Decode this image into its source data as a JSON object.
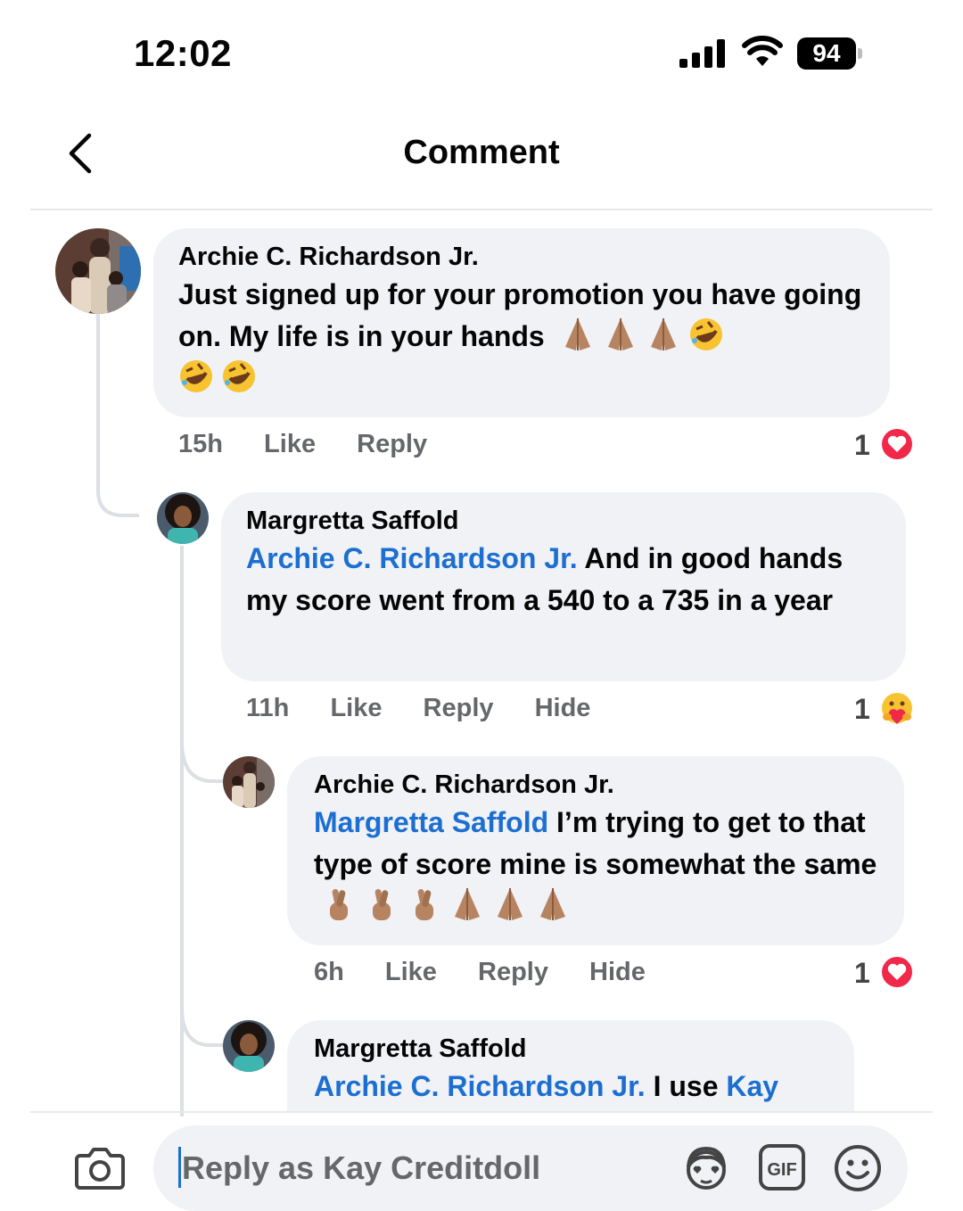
{
  "status_bar": {
    "time": "12:02",
    "battery": "94"
  },
  "header": {
    "title": "Comment"
  },
  "comments": [
    {
      "author": "Archie C. Richardson Jr.",
      "text": "Just signed up for your promotion you have going on. My life is in your hands",
      "time": "15h",
      "actions": [
        "Like",
        "Reply"
      ],
      "reaction_count": "1",
      "reaction_icon": "heart-icon"
    },
    {
      "author": "Margretta Saffold",
      "mention": "Archie C. Richardson Jr.",
      "text": " And in good hands my score went from a 540 to a 735 in a year",
      "time": "11h",
      "actions": [
        "Like",
        "Reply",
        "Hide"
      ],
      "reaction_count": "1",
      "reaction_icon": "care-face-icon"
    },
    {
      "author": "Archie C. Richardson Jr.",
      "mention": "Margretta Saffold",
      "text": " I’m trying to get to that type of score mine is somewhat the same",
      "time": "6h",
      "actions": [
        "Like",
        "Reply",
        "Hide"
      ],
      "reaction_count": "1",
      "reaction_icon": "heart-icon"
    },
    {
      "author": "Margretta Saffold",
      "mention": "Archie C. Richardson Jr.",
      "text": " I use ",
      "mention_2": "Kay"
    }
  ],
  "composer": {
    "placeholder": "Reply as Kay Creditdoll"
  },
  "colors": {
    "accent": "#1c6fd1",
    "bubble": "#f0f2f5",
    "muted": "#65676b",
    "heart": "#f02849"
  }
}
